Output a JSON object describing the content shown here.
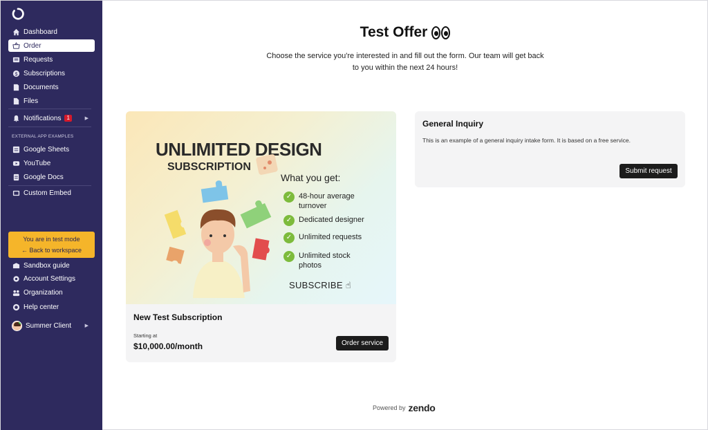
{
  "sidebar": {
    "items": [
      {
        "label": "Dashboard",
        "icon": "home-icon"
      },
      {
        "label": "Order",
        "icon": "basket-icon"
      },
      {
        "label": "Requests",
        "icon": "inbox-icon"
      },
      {
        "label": "Subscriptions",
        "icon": "dollar-icon"
      },
      {
        "label": "Documents",
        "icon": "document-icon"
      },
      {
        "label": "Files",
        "icon": "file-icon"
      }
    ],
    "notifications": {
      "label": "Notifications",
      "badge": "1"
    },
    "section_label": "EXTERNAL APP EXAMPLES",
    "external": [
      {
        "label": "Google Sheets"
      },
      {
        "label": "YouTube"
      },
      {
        "label": "Google Docs"
      }
    ],
    "custom_embed": "Custom Embed",
    "test_mode": {
      "text": "You are in test mode",
      "back": "Back to workspace"
    },
    "bottom": [
      {
        "label": "Sandbox guide"
      },
      {
        "label": "Account Settings"
      },
      {
        "label": "Organization"
      },
      {
        "label": "Help center"
      }
    ],
    "user": "Summer Client"
  },
  "main": {
    "title": "Test Offer",
    "subtitle": "Choose the service you're interested in and fill out the form. Our team will get back to you within the next 24 hours!"
  },
  "card1": {
    "hero_title": "UNLIMITED DESIGN",
    "hero_sub": "SUBSCRIPTION",
    "what": "What you get:",
    "features": [
      "48-hour average turnover",
      "Dedicated designer",
      "Unlimited requests",
      "Unlimited stock photos"
    ],
    "subscribe": "SUBSCRIBE",
    "name": "New Test Subscription",
    "starting": "Starting at",
    "price": "$10,000.00/month",
    "button": "Order service"
  },
  "card2": {
    "title": "General Inquiry",
    "desc": "This is an example of a general inquiry intake form. It is based on a free service.",
    "button": "Submit request"
  },
  "footer": {
    "powered": "Powered by",
    "brand": "zendo"
  },
  "colors": {
    "sidebar": "#2e2a5e",
    "accent": "#f5b52a",
    "badge": "#d51a2b",
    "check": "#7dbb3c"
  }
}
